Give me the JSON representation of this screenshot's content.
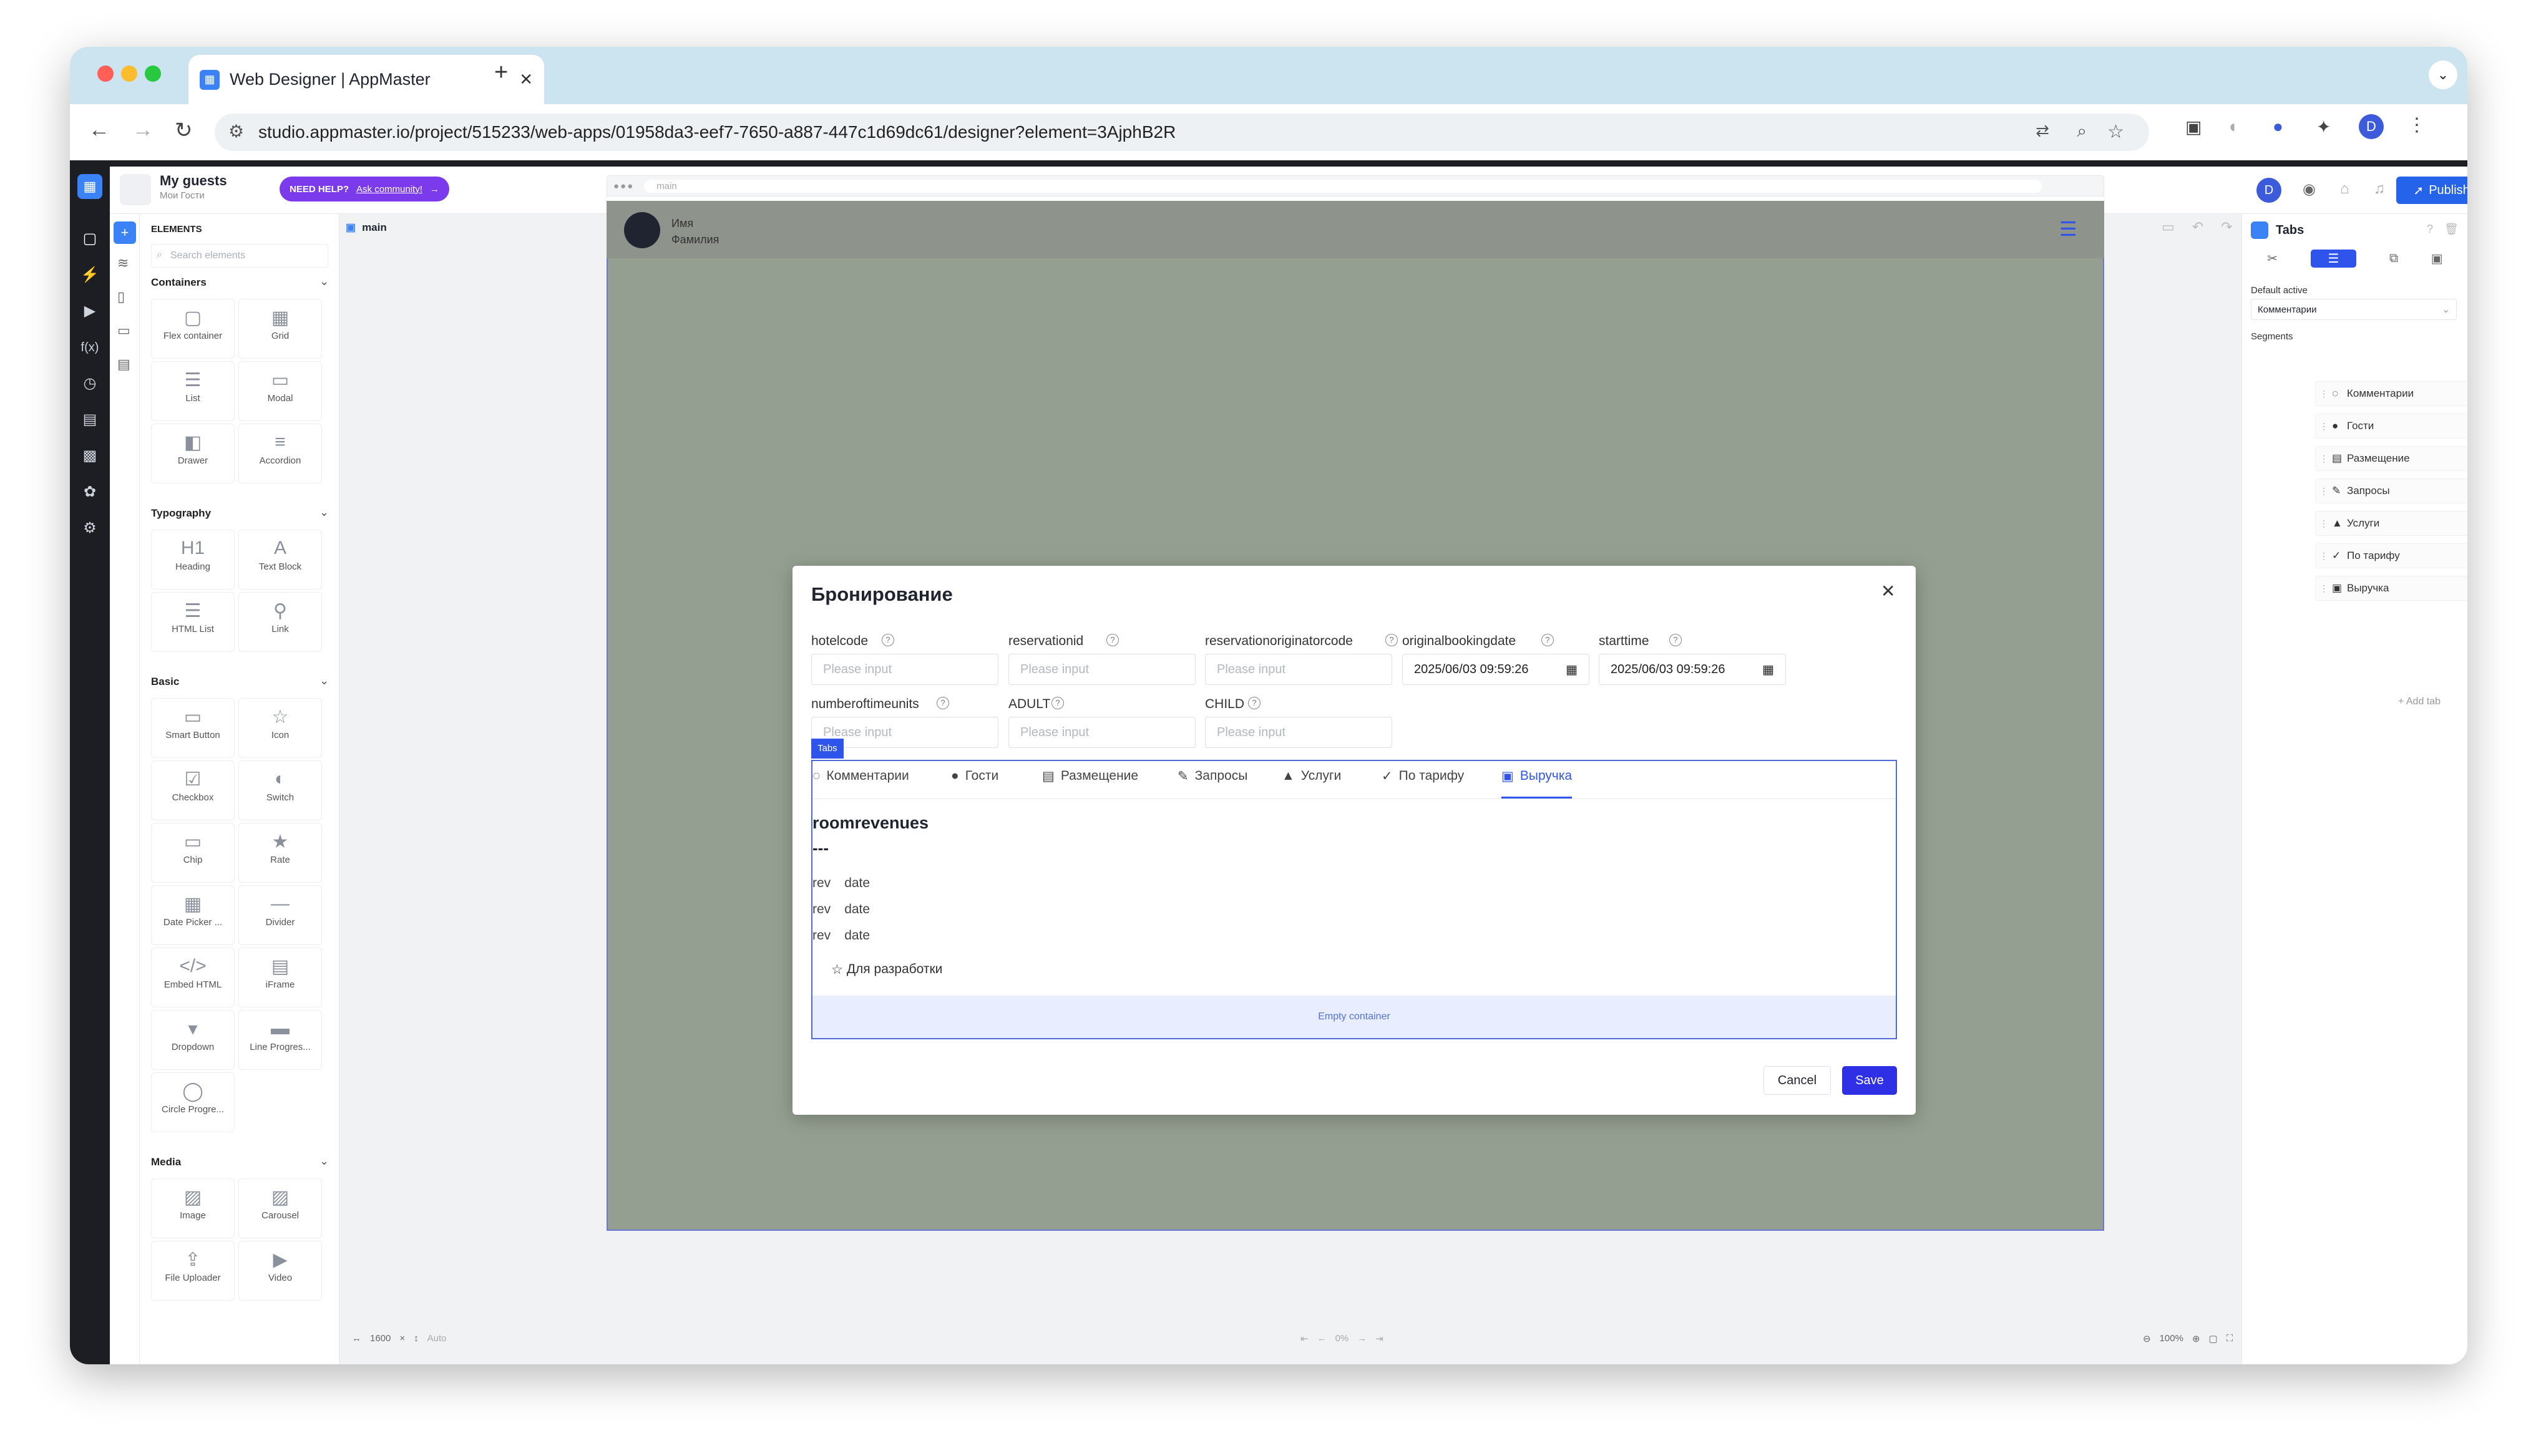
{
  "browser": {
    "tab_title": "Web Designer | AppMaster",
    "url": "studio.appmaster.io/project/515233/web-apps/01958da3-eef7-7650-a887-447c1d69dc61/designer?element=3AjphB2R",
    "profile": "D"
  },
  "app": {
    "project_name": "My guests",
    "project_sub": "Мои Гости",
    "need_help": "NEED HELP?",
    "ask_community": "Ask community!",
    "publish": "Publish",
    "user": "D"
  },
  "elements": {
    "title": "ELEMENTS",
    "search_placeholder": "Search elements",
    "sections": [
      {
        "name": "Containers",
        "items": [
          "Flex container",
          "Grid",
          "List",
          "Modal",
          "Drawer",
          "Accordion"
        ]
      },
      {
        "name": "Typography",
        "items": [
          "Heading",
          "Text Block",
          "HTML List",
          "Link"
        ]
      },
      {
        "name": "Basic",
        "items": [
          "Smart Button",
          "Icon",
          "Checkbox",
          "Switch",
          "Chip",
          "Rate",
          "Date Picker ...",
          "Divider",
          "Embed HTML",
          "iFrame",
          "Dropdown",
          "Line Progres...",
          "Circle Progre..."
        ]
      },
      {
        "name": "Media",
        "items": [
          "Image",
          "Carousel",
          "File Uploader",
          "Video"
        ]
      }
    ]
  },
  "canvas": {
    "page_name": "main",
    "frame_url": "main",
    "user_name": "Имя",
    "user_surname": "Фамилия",
    "width": "1600",
    "height": "Auto",
    "zoom": "100%",
    "progress": "0%"
  },
  "modal": {
    "title": "Бронирование",
    "fields": [
      {
        "label": "hotelcode",
        "value": "",
        "placeholder": "Please input"
      },
      {
        "label": "reservationid",
        "value": "",
        "placeholder": "Please input"
      },
      {
        "label": "reservationoriginatorcode",
        "value": "",
        "placeholder": "Please input"
      },
      {
        "label": "originalbookingdate",
        "value": "2025/06/03 09:59:26",
        "placeholder": ""
      },
      {
        "label": "starttime",
        "value": "2025/06/03 09:59:26",
        "placeholder": ""
      },
      {
        "label": "numberoftimeunits",
        "value": "",
        "placeholder": "Please input"
      },
      {
        "label": "ADULT",
        "value": "",
        "placeholder": "Please input"
      },
      {
        "label": "CHILD",
        "value": "",
        "placeholder": "Please input"
      }
    ],
    "tabs_badge": "Tabs",
    "tabs": [
      "Комментарии",
      "Гости",
      "Размещение",
      "Запросы",
      "Услуги",
      "По тарифу",
      "Выручка"
    ],
    "active_tab": "Выручка",
    "content_title": "roomrevenues",
    "content_sep": "---",
    "rows": [
      {
        "a": "rev",
        "b": "date"
      },
      {
        "a": "rev",
        "b": "date"
      },
      {
        "a": "rev",
        "b": "date"
      }
    ],
    "dev_label": "Для разработки",
    "empty_container": "Empty container",
    "cancel": "Cancel",
    "save": "Save"
  },
  "props": {
    "title": "Tabs",
    "default_active_label": "Default active",
    "default_active_value": "Комментарии",
    "segments_label": "Segments",
    "segments": [
      "Комментарии",
      "Гости",
      "Размещение",
      "Запросы",
      "Услуги",
      "По тарифу",
      "Выручка"
    ],
    "add_tab": "+ Add tab"
  },
  "colors": {
    "accent": "#2f54eb",
    "publish": "#2563eb",
    "need_help": "#7c3aed",
    "canvas_bg": "#959f91"
  }
}
